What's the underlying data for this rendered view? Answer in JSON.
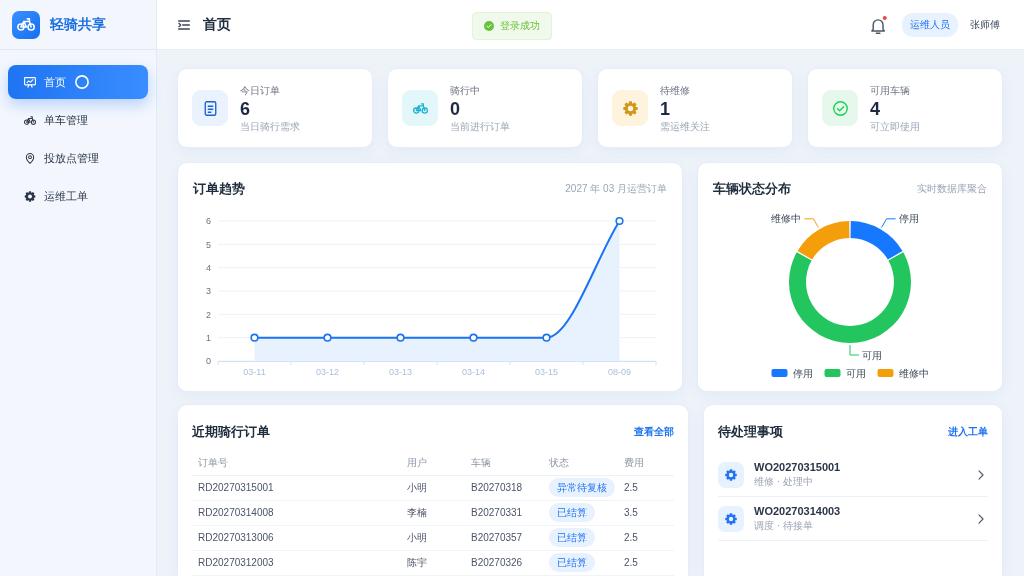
{
  "sidebar": {
    "logo_text": "轻骑共享",
    "items": [
      {
        "label": "首页",
        "selected": true,
        "loading": true
      },
      {
        "label": "单车管理",
        "selected": false,
        "loading": false
      },
      {
        "label": "投放点管理",
        "selected": false,
        "loading": false
      },
      {
        "label": "运维工单",
        "selected": false,
        "loading": false
      }
    ]
  },
  "header": {
    "title": "首页",
    "toast": "登录成功",
    "bell": {
      "unread": true
    },
    "role": "运维人员",
    "user": "张师傅"
  },
  "stats": [
    {
      "label": "今日订单",
      "value": "6",
      "note": "当日骑行需求",
      "color": "#eaf2fe"
    },
    {
      "label": "骑行中",
      "value": "0",
      "note": "当前进行订单",
      "color": "#e3f6fa"
    },
    {
      "label": "待维修",
      "value": "1",
      "note": "需运维关注",
      "color": "#fef3dc"
    },
    {
      "label": "可用车辆",
      "value": "4",
      "note": "可立即使用",
      "color": "#e6f8ec"
    }
  ],
  "trend": {
    "title": "订单趋势",
    "subtitle": "2027 年 03 月运营订单",
    "chart_data": {
      "type": "area",
      "categories": [
        "03-11",
        "03-12",
        "03-13",
        "03-14",
        "03-15",
        "08-09"
      ],
      "values": [
        1,
        1,
        1,
        1,
        1,
        6
      ],
      "ylim": [
        0,
        6
      ],
      "yticks": [
        0,
        1,
        2,
        3,
        4,
        5,
        6
      ],
      "grid": true,
      "marker": "circle"
    }
  },
  "status_dist": {
    "title": "车辆状态分布",
    "subtitle": "实时数据库聚合",
    "chart_data": {
      "type": "donut",
      "categories": [
        "停用",
        "可用",
        "维修中"
      ],
      "values": [
        16.7,
        66.6,
        16.7
      ]
    },
    "legend": [
      {
        "label": "停用",
        "color": "#1677ff"
      },
      {
        "label": "可用",
        "color": "#22c55e"
      },
      {
        "label": "维修中",
        "color": "#f59e0b"
      }
    ]
  },
  "orders": {
    "title": "近期骑行订单",
    "link": "查看全部",
    "table": {
      "columns": [
        "订单号",
        "用户",
        "车辆",
        "状态",
        "费用"
      ],
      "rows": [
        {
          "order_no": "RD20270315001",
          "user": "小明",
          "bike": "B20270318",
          "status": "异常待复核",
          "fee": "2.5"
        },
        {
          "order_no": "RD20270314008",
          "user": "李楠",
          "bike": "B20270331",
          "status": "已结算",
          "fee": "3.5"
        },
        {
          "order_no": "RD20270313006",
          "user": "小明",
          "bike": "B20270357",
          "status": "已结算",
          "fee": "2.5"
        },
        {
          "order_no": "RD20270312003",
          "user": "陈宇",
          "bike": "B20270326",
          "status": "已结算",
          "fee": "2.5"
        }
      ]
    }
  },
  "tasks": {
    "title": "待处理事项",
    "link": "进入工单",
    "items": [
      {
        "code": "WO20270315001",
        "detail": "维修 · 处理中"
      },
      {
        "code": "WO20270314003",
        "detail": "调度 · 待接单"
      }
    ]
  }
}
